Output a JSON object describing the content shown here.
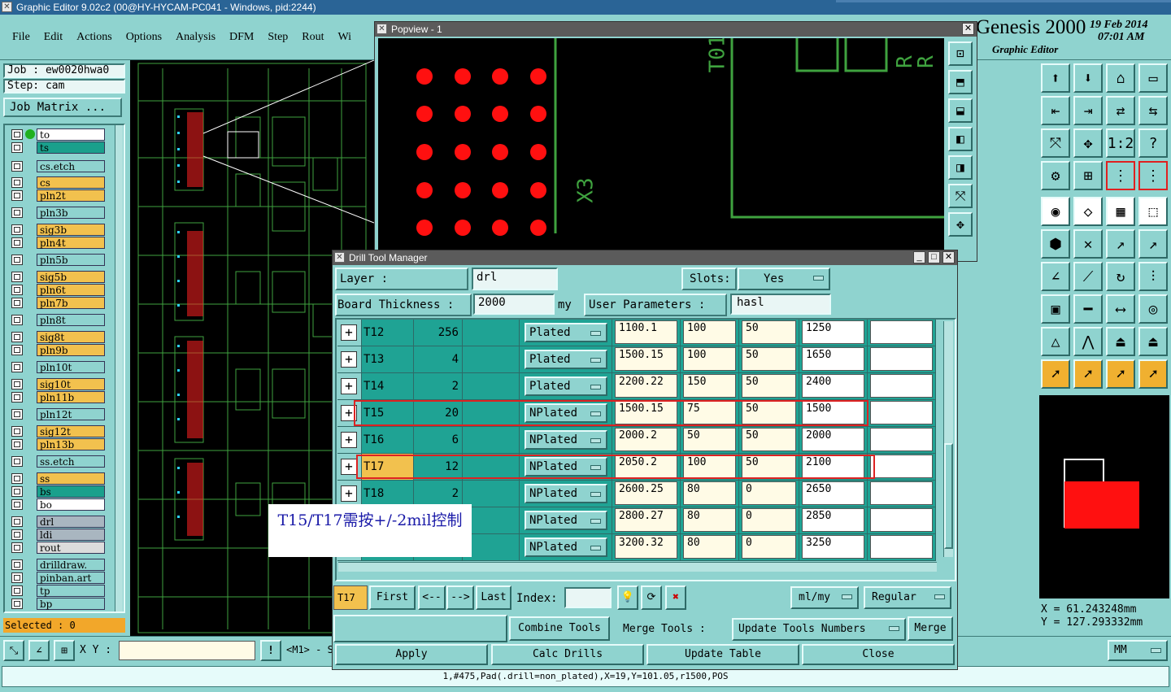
{
  "main_window": {
    "title": "Graphic Editor 9.02c2 (00@HY-HYCAM-PC041 - Windows, pid:2244)",
    "menu": [
      "File",
      "Edit",
      "Actions",
      "Options",
      "Analysis",
      "DFM",
      "Step",
      "Rout",
      "Wi"
    ],
    "brand": "Genesis 2000",
    "brand_sub": "Graphic Editor",
    "date": "19 Feb 2014",
    "time": "07:01 AM"
  },
  "job": {
    "job_label": "Job : ew0020hwa0",
    "step_label": "Step: cam",
    "matrix_button": "Job Matrix ..."
  },
  "layers": [
    {
      "name": "to",
      "color": "#ffffff"
    },
    {
      "name": "ts",
      "color": "#1aa08c"
    },
    {
      "name": "cs.etch",
      "color": "#8fd3cf"
    },
    {
      "name": "cs",
      "color": "#f2c14e"
    },
    {
      "name": "pln2t",
      "color": "#f2c14e"
    },
    {
      "name": "pln3b",
      "color": "#8fd3cf"
    },
    {
      "name": "sig3b",
      "color": "#f2c14e"
    },
    {
      "name": "pln4t",
      "color": "#f2c14e"
    },
    {
      "name": "pln5b",
      "color": "#8fd3cf"
    },
    {
      "name": "sig5b",
      "color": "#f2c14e"
    },
    {
      "name": "pln6t",
      "color": "#f2c14e"
    },
    {
      "name": "pln7b",
      "color": "#f2c14e"
    },
    {
      "name": "pln8t",
      "color": "#8fd3cf"
    },
    {
      "name": "sig8t",
      "color": "#f2c14e"
    },
    {
      "name": "pln9b",
      "color": "#f2c14e"
    },
    {
      "name": "pln10t",
      "color": "#8fd3cf"
    },
    {
      "name": "sig10t",
      "color": "#f2c14e"
    },
    {
      "name": "pln11b",
      "color": "#f2c14e"
    },
    {
      "name": "pln12t",
      "color": "#8fd3cf"
    },
    {
      "name": "sig12t",
      "color": "#f2c14e"
    },
    {
      "name": "pln13b",
      "color": "#f2c14e"
    },
    {
      "name": "ss.etch",
      "color": "#8fd3cf"
    },
    {
      "name": "ss",
      "color": "#f2c14e"
    },
    {
      "name": "bs",
      "color": "#1aa08c"
    },
    {
      "name": "bo",
      "color": "#ffffff"
    },
    {
      "name": "drl",
      "color": "#a9b6c0"
    },
    {
      "name": "ldi",
      "color": "#a9b6c0"
    },
    {
      "name": "rout",
      "color": "#dcdcdc"
    },
    {
      "name": "drilldraw.",
      "color": "#8fd3cf"
    },
    {
      "name": "pinban.art",
      "color": "#8fd3cf"
    },
    {
      "name": "tp",
      "color": "#8fd3cf"
    },
    {
      "name": "bp",
      "color": "#8fd3cf"
    }
  ],
  "status": {
    "selected": "Selected : 0",
    "xy_label": "X Y :",
    "xy_value": "",
    "m1": "<M1> - S",
    "units": "MM",
    "bottom_line": "1,#475,Pad(.drill=non_plated),X=19,Y=101.05,r1500,POS"
  },
  "coords": {
    "x": "X  =   61.243248mm",
    "y": "Y  =  127.293332mm"
  },
  "popview": {
    "title": "Popview - 1",
    "labels": [
      "T01",
      "X3",
      "R",
      "R"
    ]
  },
  "dtm": {
    "title": "Drill Tool Manager",
    "layer_label": "Layer       :",
    "layer_value": "drl",
    "slots_label": "Slots:",
    "slots_value": "Yes",
    "thickness_label": "Board Thickness  :",
    "thickness_value": "2000",
    "thickness_unit": "my",
    "user_params_label": "User Parameters  :",
    "user_params_value": "hasl",
    "rows": [
      {
        "tool": "T12",
        "count": "256",
        "type": "Plated",
        "size": "1100.1",
        "p1": "100",
        "p2": "50",
        "finish": "1250"
      },
      {
        "tool": "T13",
        "count": "4",
        "type": "Plated",
        "size": "1500.15",
        "p1": "100",
        "p2": "50",
        "finish": "1650"
      },
      {
        "tool": "T14",
        "count": "2",
        "type": "Plated",
        "size": "2200.22",
        "p1": "150",
        "p2": "50",
        "finish": "2400"
      },
      {
        "tool": "T15",
        "count": "20",
        "type": "NPlated",
        "size": "1500.15",
        "p1": "75",
        "p2": "50",
        "finish": "1500"
      },
      {
        "tool": "T16",
        "count": "6",
        "type": "NPlated",
        "size": "2000.2",
        "p1": "50",
        "p2": "50",
        "finish": "2000"
      },
      {
        "tool": "T17",
        "count": "12",
        "type": "NPlated",
        "size": "2050.2",
        "p1": "100",
        "p2": "50",
        "finish": "2100"
      },
      {
        "tool": "T18",
        "count": "2",
        "type": "NPlated",
        "size": "2600.25",
        "p1": "80",
        "p2": "0",
        "finish": "2650"
      },
      {
        "tool": "",
        "count": "",
        "type": "NPlated",
        "size": "2800.27",
        "p1": "80",
        "p2": "0",
        "finish": "2850"
      },
      {
        "tool": "",
        "count": "",
        "type": "NPlated",
        "size": "3200.32",
        "p1": "80",
        "p2": "0",
        "finish": "3250"
      }
    ],
    "current_tool": "T17",
    "nav": {
      "first": "First",
      "prev": "<--",
      "next": "-->",
      "last": "Last",
      "index": "Index:"
    },
    "units_dd": "ml/my",
    "mode_dd": "Regular",
    "combine": "Combine Tools",
    "merge_label": "Merge Tools  :",
    "merge_dd": "Update Tools Numbers",
    "merge_btn": "Merge",
    "apply": "Apply",
    "calc": "Calc Drills",
    "update": "Update Table",
    "close": "Close"
  },
  "annotation": "T15/T17需按+/-2mil控制"
}
